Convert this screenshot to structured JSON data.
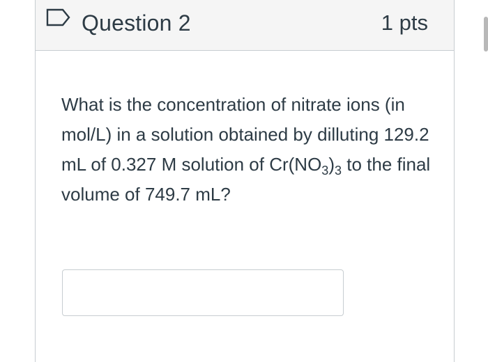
{
  "question": {
    "title": "Question 2",
    "points": "1 pts",
    "flag_icon": "flag-outline-icon",
    "text_part1": "What is the concentration of nitrate ions (in mol/L) in a solution obtained by dilluting 129.2 mL of 0.327 M solution of Cr(NO",
    "sub1": "3",
    "text_part2": ")",
    "sub2": "3",
    "text_part3": " to the final volume of 749.7 mL?",
    "answer_value": ""
  },
  "colors": {
    "header_bg": "#f5f5f5",
    "border": "#c7cdd1",
    "flag_stroke": "#2d3b45",
    "text": "#2d3b45"
  }
}
